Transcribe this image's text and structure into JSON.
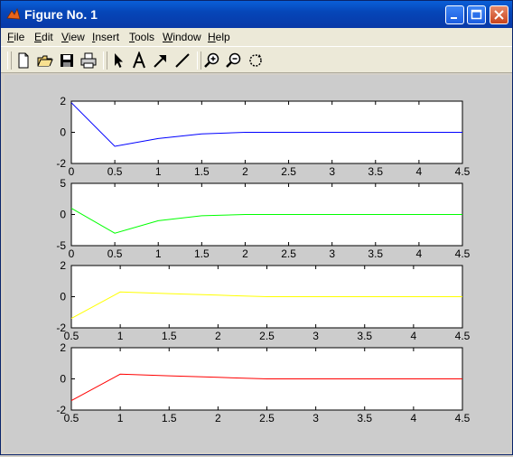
{
  "window": {
    "title": "Figure No. 1"
  },
  "titlebar_buttons": {
    "minimize": "minimize",
    "maximize": "maximize",
    "close": "close"
  },
  "menu": {
    "items": [
      {
        "label": "File",
        "accel": "F"
      },
      {
        "label": "Edit",
        "accel": "E"
      },
      {
        "label": "View",
        "accel": "V"
      },
      {
        "label": "Insert",
        "accel": "I"
      },
      {
        "label": "Tools",
        "accel": "T"
      },
      {
        "label": "Window",
        "accel": "W"
      },
      {
        "label": "Help",
        "accel": "H"
      }
    ]
  },
  "toolbar": {
    "icons": [
      "new-file-icon",
      "open-file-icon",
      "save-icon",
      "print-icon",
      "pointer-arrow-icon",
      "insert-text-icon",
      "insert-arrow-icon",
      "insert-line-icon",
      "zoom-in-icon",
      "zoom-out-icon",
      "rotate-3d-icon"
    ]
  },
  "colors": {
    "figure_bg": "#cccccc",
    "axes_bg": "#ffffff",
    "s1": "#0000ff",
    "s2": "#00ff00",
    "s3": "#ffff00",
    "s4": "#ff0000"
  },
  "chart_data": [
    {
      "type": "line",
      "xlim": [
        0,
        4.5
      ],
      "ylim": [
        -2,
        2
      ],
      "xticks": [
        "0",
        "0.5",
        "1",
        "1.5",
        "2",
        "2.5",
        "3",
        "3.5",
        "4",
        "4.5"
      ],
      "yticks": [
        "-2",
        "0",
        "2"
      ],
      "series": [
        {
          "color": "#0000ff",
          "x": [
            0,
            0.5,
            1,
            1.5,
            2,
            2.5,
            3,
            3.5,
            4,
            4.5
          ],
          "y": [
            1.9,
            -0.9,
            -0.4,
            -0.1,
            0,
            0,
            0,
            0,
            0,
            0
          ]
        }
      ]
    },
    {
      "type": "line",
      "xlim": [
        0,
        4.5
      ],
      "ylim": [
        -5,
        5
      ],
      "xticks": [
        "0",
        "0.5",
        "1",
        "1.5",
        "2",
        "2.5",
        "3",
        "3.5",
        "4",
        "4.5"
      ],
      "yticks": [
        "-5",
        "0",
        "5"
      ],
      "series": [
        {
          "color": "#00ff00",
          "x": [
            0,
            0.5,
            1,
            1.5,
            2,
            2.5,
            3,
            3.5,
            4,
            4.5
          ],
          "y": [
            1,
            -3,
            -1,
            -0.2,
            0,
            0,
            0,
            0,
            0,
            0
          ]
        }
      ]
    },
    {
      "type": "line",
      "xlim": [
        0.5,
        4.5
      ],
      "ylim": [
        -2,
        2
      ],
      "xticks": [
        "0.5",
        "1",
        "1.5",
        "2",
        "2.5",
        "3",
        "3.5",
        "4",
        "4.5"
      ],
      "yticks": [
        "-2",
        "0",
        "2"
      ],
      "series": [
        {
          "color": "#ffff00",
          "x": [
            0.5,
            1,
            1.5,
            2,
            2.5,
            3,
            3.5,
            4,
            4.5
          ],
          "y": [
            -1.4,
            0.3,
            0.2,
            0.1,
            0,
            0,
            0,
            0,
            0
          ]
        }
      ]
    },
    {
      "type": "line",
      "xlim": [
        0.5,
        4.5
      ],
      "ylim": [
        -2,
        2
      ],
      "xticks": [
        "0.5",
        "1",
        "1.5",
        "2",
        "2.5",
        "3",
        "3.5",
        "4",
        "4.5"
      ],
      "yticks": [
        "-2",
        "0",
        "2"
      ],
      "series": [
        {
          "color": "#ff0000",
          "x": [
            0.5,
            1,
            1.5,
            2,
            2.5,
            3,
            3.5,
            4,
            4.5
          ],
          "y": [
            -1.4,
            0.3,
            0.2,
            0.1,
            0,
            0,
            0,
            0,
            0
          ]
        }
      ]
    }
  ]
}
